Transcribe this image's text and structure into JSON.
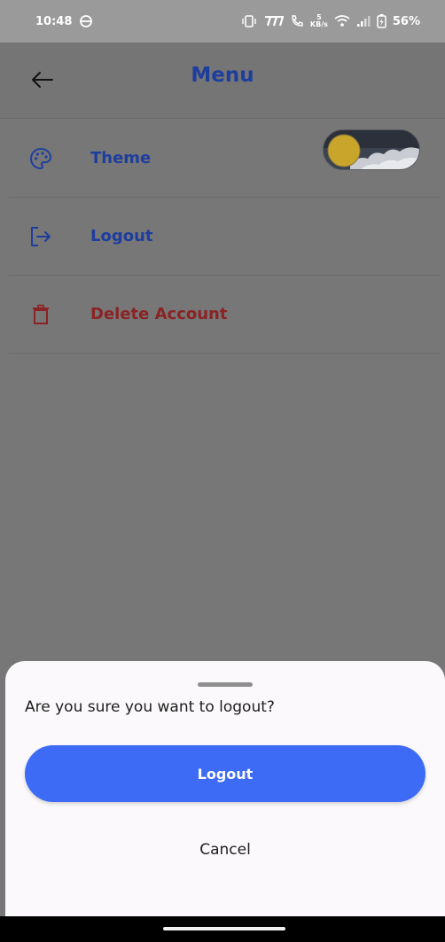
{
  "status_bar": {
    "time": "10:48",
    "network_speed_value": "5",
    "network_speed_unit": "KB/s",
    "battery": "56%",
    "icons": [
      "vpn-icon",
      "vibrate-icon",
      "volte-icon",
      "wifi-call-icon",
      "wifi-icon",
      "signal-icon",
      "battery-icon"
    ]
  },
  "app_bar": {
    "title": "Menu",
    "back_icon": "arrow-left-icon"
  },
  "menu": {
    "items": [
      {
        "label": "Theme",
        "icon": "palette-icon"
      },
      {
        "label": "Logout",
        "icon": "logout-icon"
      },
      {
        "label": "Delete Account",
        "icon": "trash-icon"
      }
    ],
    "theme_toggle_state": "light"
  },
  "sheet": {
    "question": "Are you sure you want to logout?",
    "confirm_label": "Logout",
    "cancel_label": "Cancel"
  },
  "colors": {
    "accent": "#3d6bf5",
    "primary_text": "#1e3e9e",
    "danger": "#8a2323",
    "scrim": "#777777"
  }
}
